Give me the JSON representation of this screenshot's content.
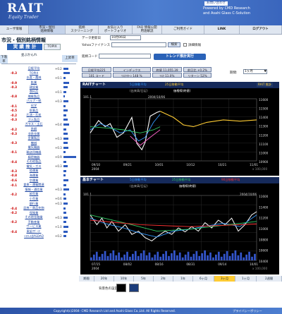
{
  "header": {
    "logo": "RAIT",
    "subtitle": "Equity Trader",
    "powered_line1": "Powered by CMD Research",
    "powered_line2": "and Asahi Glass C-Solution",
    "top_link": "お問い合わせ"
  },
  "nav": [
    {
      "label": "ユーザ情報"
    },
    {
      "label": "市況・個別\n銘柄情報"
    },
    {
      "label": "銘柄\nスクリーニング"
    },
    {
      "label": "お気に入り\nポートフォリオ"
    },
    {
      "label": "FAQ 情報公開\n用語解説"
    },
    {
      "label": "ご利用ガイド"
    },
    {
      "label": "LINK"
    },
    {
      "label": "ログアウト"
    }
  ],
  "left": {
    "title": "市況・個別銘柄情報",
    "tab_label": "実 績 推 計",
    "toggle_label": "TOPIX",
    "sidebar_top": "上昇率",
    "sort_label": "並ぶかんれ",
    "mini_head": "下落率",
    "list": [
      {
        "neg": "",
        "name": "日経平均",
        "val": "+0.2",
        "bar": 0.3
      },
      {
        "neg": "-0.3",
        "name": "TOPIX",
        "val": "",
        "bar": 0.4
      },
      {
        "neg": "",
        "name": "水産・農林",
        "val": "+0.1",
        "bar": 0.15
      },
      {
        "neg": "-0.9",
        "name": "鉱業",
        "val": "",
        "bar": 0.35
      },
      {
        "neg": "-0.3",
        "name": "建設業",
        "val": "",
        "bar": 0.25
      },
      {
        "neg": "",
        "name": "食料品",
        "val": "+0.1",
        "bar": 0.2
      },
      {
        "neg": "-0.8",
        "name": "繊維製品",
        "val": "",
        "bar": 0.1
      },
      {
        "neg": "",
        "name": "パルプ・紙",
        "val": "+0.3",
        "bar": 0.3
      },
      {
        "neg": "-0.1",
        "name": "化学",
        "val": "",
        "bar": 0.15
      },
      {
        "neg": "-0.5",
        "name": "医薬品",
        "val": "",
        "bar": 0.25
      },
      {
        "neg": "-0.2",
        "name": "石油・石炭",
        "val": "",
        "bar": 0.2
      },
      {
        "neg": "-0.3",
        "name": "ゴム製品",
        "val": "",
        "bar": 0.25
      },
      {
        "neg": "",
        "name": "ガラス・土石",
        "val": "+0.4",
        "bar": 0.35
      },
      {
        "neg": "-0.2",
        "name": "鉄鋼",
        "val": "",
        "bar": 0.2
      },
      {
        "neg": "-0.3",
        "name": "非鉄金属",
        "val": "",
        "bar": 0.25
      },
      {
        "neg": "",
        "name": "金属製品",
        "val": "+0.3",
        "bar": 0.3
      },
      {
        "neg": "-0.3",
        "name": "機械",
        "val": "",
        "bar": 0.25
      },
      {
        "neg": "",
        "name": "電気機器",
        "val": "+0.3",
        "bar": 0.3
      },
      {
        "neg": "-0.1",
        "name": "輸送用機器",
        "val": "",
        "bar": 0.15
      },
      {
        "neg": "",
        "name": "精密機器",
        "val": "+0.9",
        "bar": 0.8
      },
      {
        "neg": "-0.4",
        "name": "その他製品",
        "val": "",
        "bar": 0.2
      },
      {
        "neg": "",
        "name": "電気・ガス",
        "val": "+0.3",
        "bar": 0.25
      },
      {
        "neg": "-0.3",
        "name": "陸運業",
        "val": "",
        "bar": 0.2
      },
      {
        "neg": "-0.8",
        "name": "海運業",
        "val": "",
        "bar": 0.15
      },
      {
        "neg": "-0.6",
        "name": "空運業",
        "val": "",
        "bar": 0.3
      },
      {
        "neg": "-0.1",
        "name": "倉庫・運輸関連",
        "val": "",
        "bar": 0.2
      },
      {
        "neg": "",
        "name": "情報・通信業",
        "val": "+0.3",
        "bar": 0.35
      },
      {
        "neg": "-0.2",
        "name": "卸売業",
        "val": "",
        "bar": 0.15
      },
      {
        "neg": "",
        "name": "小売業",
        "val": "+0.6",
        "bar": 0.2
      },
      {
        "neg": "",
        "name": "銀行業",
        "val": "+0.3",
        "bar": 0.25
      },
      {
        "neg": "-0.4",
        "name": "証券・商品先物",
        "val": "",
        "bar": 0.15
      },
      {
        "neg": "-0.2",
        "name": "保険業",
        "val": "",
        "bar": 0.2
      },
      {
        "neg": "",
        "name": "その他金融業",
        "val": "+0.3",
        "bar": 0.25
      },
      {
        "neg": "-0.2",
        "name": "不動産業",
        "val": "",
        "bar": 0.2
      },
      {
        "neg": "",
        "name": "サービス業",
        "val": "+1.0",
        "bar": 0.3
      },
      {
        "neg": "-0.4",
        "name": "東証ﾏｻﾞｰｽﾞ",
        "val": "",
        "bar": 0.25
      },
      {
        "neg": "",
        "name": "ﾍﾗｸﾚｽ/JASDAQ",
        "val": "+0.2",
        "bar": 0.2
      }
    ]
  },
  "form": {
    "date_label": "データ更新日",
    "date_value": "10月06日",
    "yahoo_label": "Yahooファイナンス",
    "search_button": "検索",
    "detail_link": "詳細情報",
    "code_label": "銘柄コード",
    "trend_button": "トレンド推計実行",
    "period_label": "期間:",
    "period_value": "1ヶ月"
  },
  "info_tabs": [
    {
      "label": "日経平均225"
    },
    {
      "label": "インデックス"
    },
    {
      "label": "終値 11,055.39"
    },
    {
      "label": "前日比 +0.2%"
    },
    {
      "label": "101 コード"
    },
    {
      "label": "ﾘｽｸﾘﾀｰﾝ 148 %"
    },
    {
      "label": "ﾘｽｸ 11.0%"
    },
    {
      "label": "リターン 52%"
    }
  ],
  "chart1": {
    "header": "RAITチャート",
    "legend": {
      "ma5": "5日移動平均",
      "ma25": "25日移動平均",
      "price_label": "価格線(終値)",
      "side": "RAIT\n推計",
      "unit": "(出来高/日足)"
    },
    "top_left": "101.1",
    "date_mark": "2004/10/06",
    "y_ticks": [
      "11600",
      "11500",
      "11400",
      "11300",
      "11200",
      "11100",
      "11000",
      "10900"
    ],
    "x_ticks": [
      "09/10",
      "09/21",
      "10/01",
      "10/12",
      "10/21",
      "11/01"
    ],
    "x_year": "2004",
    "footer": "x 100,000"
  },
  "chart2": {
    "header": "基本チャート",
    "legend": {
      "ma5": "5日移動平均",
      "ma25": "25日移動平均",
      "ma90": "90日移動平均",
      "price_label": "価格線(終値)",
      "unit": "(出来高/日足)"
    },
    "top_left": "101.1",
    "date_mark": "2004/10/06",
    "y_ticks": [
      "11600",
      "11400",
      "11200",
      "11000",
      "10800",
      "10600",
      "10400"
    ],
    "x_ticks": [
      "07/15",
      "08/02",
      "08/16",
      "08/31",
      "09/14",
      "10/01"
    ],
    "x_year": "2004",
    "footer": "x 100,000"
  },
  "period_bar": {
    "label": "期間",
    "items": [
      "20年",
      "10年",
      "5年",
      "2年",
      "1年",
      "6ヶ月",
      "3ヶ月",
      "1ヶ月",
      "2週間"
    ],
    "active": "3ヶ月"
  },
  "bg_label": "背景色の設定",
  "footer": {
    "copyright": "Copyright(c)2004- CMD Research Ltd and Asahi Glass Co.,Ltd. All Rights Reserved.",
    "policy": "プライバシーポリシー"
  },
  "colors": {
    "accent": "#2a62b8",
    "chart_bg": "#000000",
    "ma5": "#3399ff",
    "ma25": "#ffcc33",
    "ma90": "#ff3333",
    "price": "#ffffff",
    "trend": "#33cc66"
  }
}
